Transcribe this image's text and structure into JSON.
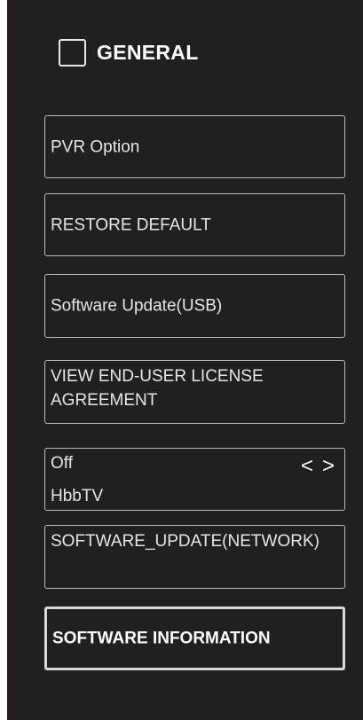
{
  "header": {
    "icon": "checkbox-square-icon",
    "title": "GENERAL"
  },
  "menu": {
    "pvr_option": "PVR Option",
    "restore_default": "RESTORE DEFAULT",
    "software_update_usb": "Software Update(USB)",
    "eula": "VIEW END-USER LICENSE AGREEMENT",
    "hbbtv": {
      "value": "Off",
      "label": "HbbTV",
      "left_arrow": "<",
      "right_arrow": ">"
    },
    "software_update_network": "SOFTWARE_UPDATE(NETWORK)",
    "software_information": "SOFTWARE INFORMATION"
  },
  "colors": {
    "background": "#231f20",
    "text": "#e6e6e6",
    "border": "#bcbcbc",
    "focus_border": "#d9d9d9"
  }
}
